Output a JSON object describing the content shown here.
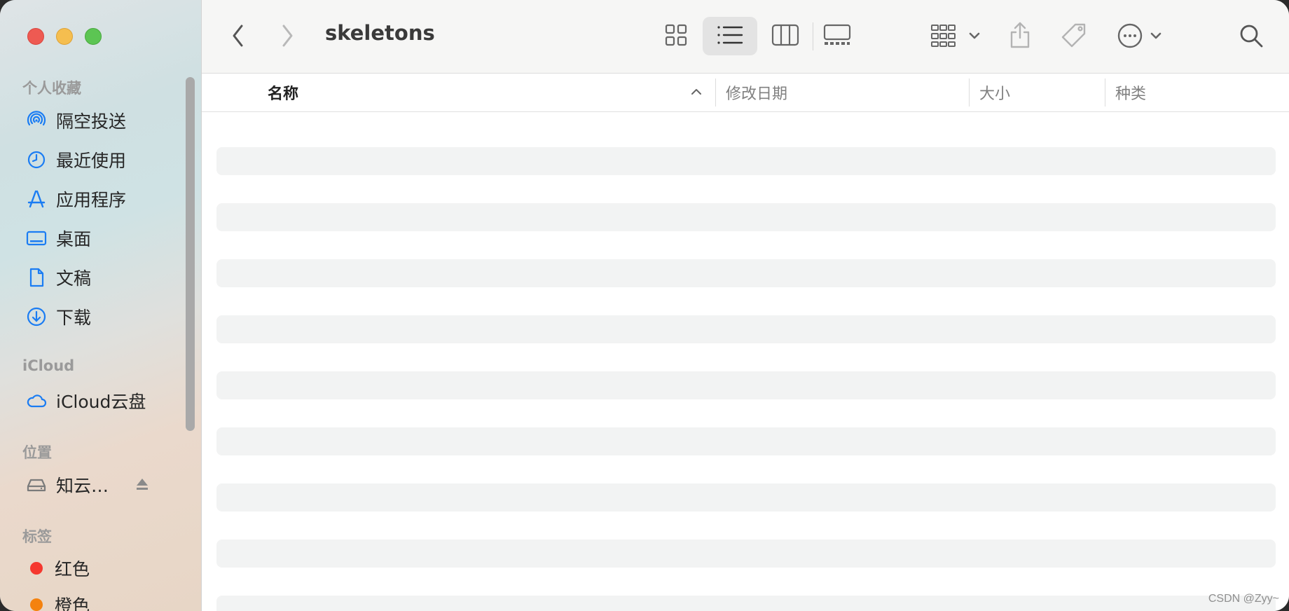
{
  "window": {
    "title": "skeletons"
  },
  "sidebar": {
    "favorites_title": "个人收藏",
    "favorites": [
      {
        "label": "隔空投送",
        "icon": "airdrop-icon"
      },
      {
        "label": "最近使用",
        "icon": "clock-icon"
      },
      {
        "label": "应用程序",
        "icon": "applications-icon"
      },
      {
        "label": "桌面",
        "icon": "desktop-icon"
      },
      {
        "label": "文稿",
        "icon": "document-icon"
      },
      {
        "label": "下载",
        "icon": "download-icon"
      }
    ],
    "icloud_title": "iCloud",
    "icloud_items": [
      {
        "label": "iCloud云盘",
        "icon": "cloud-icon"
      }
    ],
    "locations_title": "位置",
    "locations": [
      {
        "label": "知云…",
        "icon": "drive-icon"
      }
    ],
    "tags_title": "标签",
    "tags": [
      {
        "label": "红色",
        "color": "#f5382f"
      },
      {
        "label": "橙色",
        "color": "#f4820f"
      }
    ]
  },
  "columns": {
    "name": "名称",
    "modified": "修改日期",
    "size": "大小",
    "kind": "种类"
  },
  "colors": {
    "accent": "#1a7cf3",
    "skeleton": "#f2f3f3"
  },
  "watermark": "CSDN @Zyy~"
}
